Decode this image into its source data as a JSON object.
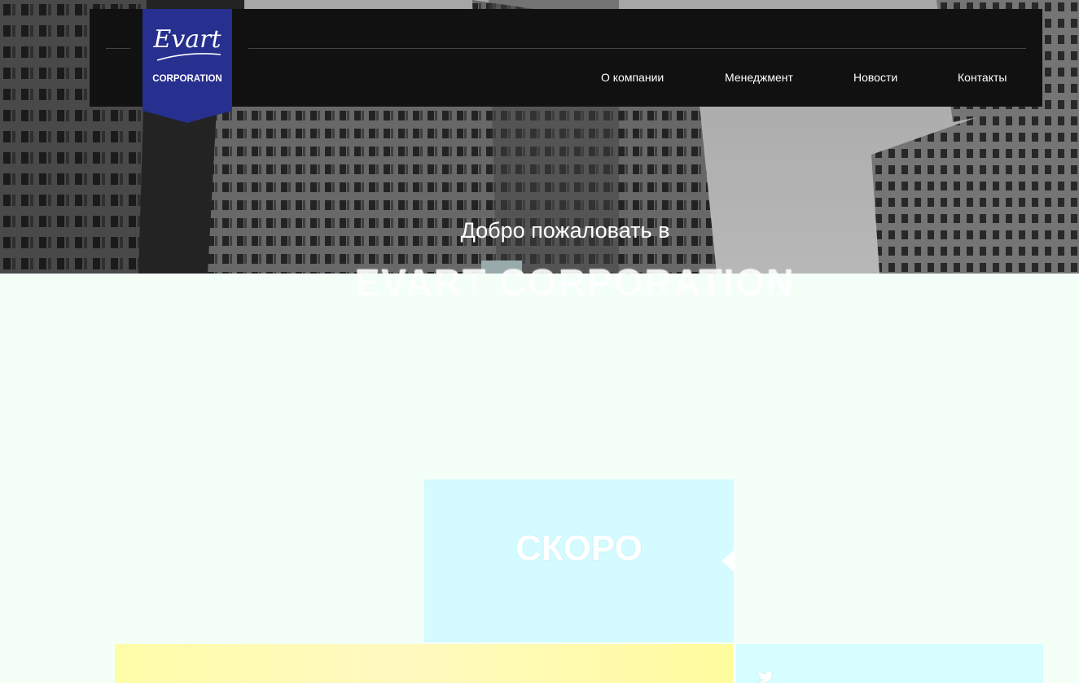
{
  "brand": {
    "script_name": "Evart",
    "corporation": "CORPORATION",
    "badge_color": "#272f8f"
  },
  "nav": {
    "items": [
      {
        "label": "О компании"
      },
      {
        "label": "Менеджмент"
      },
      {
        "label": "Новости"
      },
      {
        "label": "Контакты"
      }
    ]
  },
  "hero": {
    "welcome": "Добро пожаловать в",
    "company": "EVART CORPORATION"
  },
  "content": {
    "section_heading": "",
    "coming_soon": {
      "title": "СКОРО",
      "subtitle": ""
    }
  },
  "social": {
    "icon": "twitter-icon"
  },
  "colors": {
    "page_background": "#f4fff8",
    "coming_box": "#d4fbff",
    "yellow_band": "#fffca8",
    "nav_background": "#111111"
  }
}
